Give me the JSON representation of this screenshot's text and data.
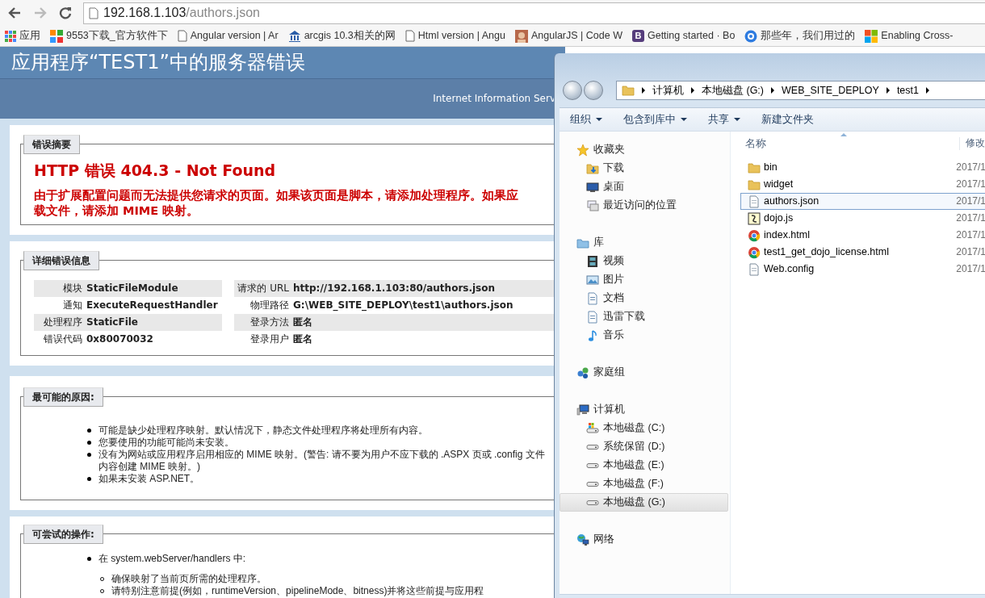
{
  "browser": {
    "address": {
      "host": "192.168.1.103",
      "path": "/authors.json"
    }
  },
  "bookmarks": [
    {
      "label": "应用",
      "kind": "apps"
    },
    {
      "label": "9553下载_官方软件下",
      "kind": "tiles"
    },
    {
      "label": "Angular version | Ar",
      "kind": "page"
    },
    {
      "label": "arcgis 10.3相关的网",
      "kind": "site"
    },
    {
      "label": "Html version | Angu",
      "kind": "page"
    },
    {
      "label": "AngularJS | Code W",
      "kind": "avatar"
    },
    {
      "label": "Getting started · Bo",
      "kind": "badge",
      "badge": "B"
    },
    {
      "label": "那些年，我们用过的",
      "kind": "circle"
    },
    {
      "label": "Enabling Cross-",
      "kind": "windows"
    }
  ],
  "error_page": {
    "title": "应用程序“TEST1”中的服务器错误",
    "server": "Internet Information Serv",
    "sections": [
      {
        "kind": "summary",
        "legend": "错误摘要",
        "heading": "HTTP 错误 404.3 - Not Found",
        "lines": [
          "由于扩展配置问题而无法提供您请求的页面。如果该页面是脚本，请添加处理程序。如果应",
          "载文件，请添加 MIME 映射。"
        ]
      },
      {
        "kind": "details",
        "legend": "详细错误信息",
        "left": [
          {
            "label": "模块",
            "value": "StaticFileModule"
          },
          {
            "label": "通知",
            "value": "ExecuteRequestHandler"
          },
          {
            "label": "处理程序",
            "value": "StaticFile"
          },
          {
            "label": "错误代码",
            "value": "0x80070032"
          }
        ],
        "right": [
          {
            "label": "请求的 URL",
            "value": "http://192.168.1.103:80/authors.json"
          },
          {
            "label": "物理路径",
            "value": "G:\\WEB_SITE_DEPLOY\\test1\\authors.json"
          },
          {
            "label": "登录方法",
            "value": "匿名"
          },
          {
            "label": "登录用户",
            "value": "匿名"
          }
        ]
      },
      {
        "kind": "list",
        "legend": "最可能的原因:",
        "items": [
          {
            "lines": [
              "可能是缺少处理程序映射。默认情况下，静态文件处理程序将处理所有内容。"
            ]
          },
          {
            "lines": [
              "您要使用的功能可能尚未安装。"
            ]
          },
          {
            "lines": [
              "没有为网站或应用程序启用相应的 MIME 映射。(警告: 请不要为用户不应下载的 .ASPX 页或 .config 文件",
              "内容创建 MIME 映射。)"
            ]
          },
          {
            "lines": [
              "如果未安装 ASP.NET。"
            ]
          }
        ]
      },
      {
        "kind": "list",
        "legend": "可尝试的操作:",
        "items": [
          {
            "lines": [
              "在 system.webServer/handlers 中:"
            ],
            "children": [
              {
                "lines": [
                  "确保映射了当前页所需的处理程序。"
                ]
              },
              {
                "lines": [
                  "请特别注意前提(例如，runtimeVersion、pipelineMode、bitness)并将这些前提与应用程"
                ]
              }
            ]
          }
        ]
      }
    ]
  },
  "explorer": {
    "breadcrumb": [
      "计算机",
      "本地磁盘 (G:)",
      "WEB_SITE_DEPLOY",
      "test1"
    ],
    "toolbar": [
      {
        "label": "组织",
        "dropdown": true
      },
      {
        "label": "包含到库中",
        "dropdown": true
      },
      {
        "label": "共享",
        "dropdown": true
      },
      {
        "label": "新建文件夹",
        "dropdown": false
      }
    ],
    "nav": [
      {
        "label": "收藏夹",
        "kind": "favorites",
        "selected": false,
        "children": [
          {
            "label": "下载",
            "kind": "downloads",
            "selected": false
          },
          {
            "label": "桌面",
            "kind": "desktop",
            "selected": false
          },
          {
            "label": "最近访问的位置",
            "kind": "recent",
            "selected": false
          }
        ]
      },
      {
        "label": "库",
        "kind": "library",
        "selected": false,
        "children": [
          {
            "label": "视频",
            "kind": "video",
            "selected": false
          },
          {
            "label": "图片",
            "kind": "pictures",
            "selected": false
          },
          {
            "label": "文档",
            "kind": "documents",
            "selected": false
          },
          {
            "label": "迅雷下载",
            "kind": "documents",
            "selected": false
          },
          {
            "label": "音乐",
            "kind": "music",
            "selected": false
          }
        ]
      },
      {
        "label": "家庭组",
        "kind": "homegroup",
        "selected": false
      },
      {
        "label": "计算机",
        "kind": "computer",
        "selected": false,
        "children": [
          {
            "label": "本地磁盘 (C:)",
            "kind": "system-drive",
            "selected": false
          },
          {
            "label": "系统保留 (D:)",
            "kind": "drive",
            "selected": false
          },
          {
            "label": "本地磁盘 (E:)",
            "kind": "drive",
            "selected": false
          },
          {
            "label": "本地磁盘 (F:)",
            "kind": "drive",
            "selected": false
          },
          {
            "label": "本地磁盘 (G:)",
            "kind": "drive",
            "selected": true
          }
        ]
      },
      {
        "label": "网络",
        "kind": "network",
        "selected": false
      }
    ],
    "columns": [
      "名称",
      "修改"
    ],
    "files": [
      {
        "name": "bin",
        "kind": "folder",
        "date": "2017/1",
        "selected": false
      },
      {
        "name": "widget",
        "kind": "folder",
        "date": "2017/1",
        "selected": false
      },
      {
        "name": "authors.json",
        "kind": "document",
        "date": "2017/1",
        "selected": true
      },
      {
        "name": "dojo.js",
        "kind": "script",
        "date": "2017/1",
        "selected": false
      },
      {
        "name": "index.html",
        "kind": "webpage",
        "date": "2017/1",
        "selected": false
      },
      {
        "name": "test1_get_dojo_license.html",
        "kind": "webpage",
        "date": "2017/1",
        "selected": false
      },
      {
        "name": "Web.config",
        "kind": "document",
        "date": "2017/1",
        "selected": false
      }
    ]
  }
}
